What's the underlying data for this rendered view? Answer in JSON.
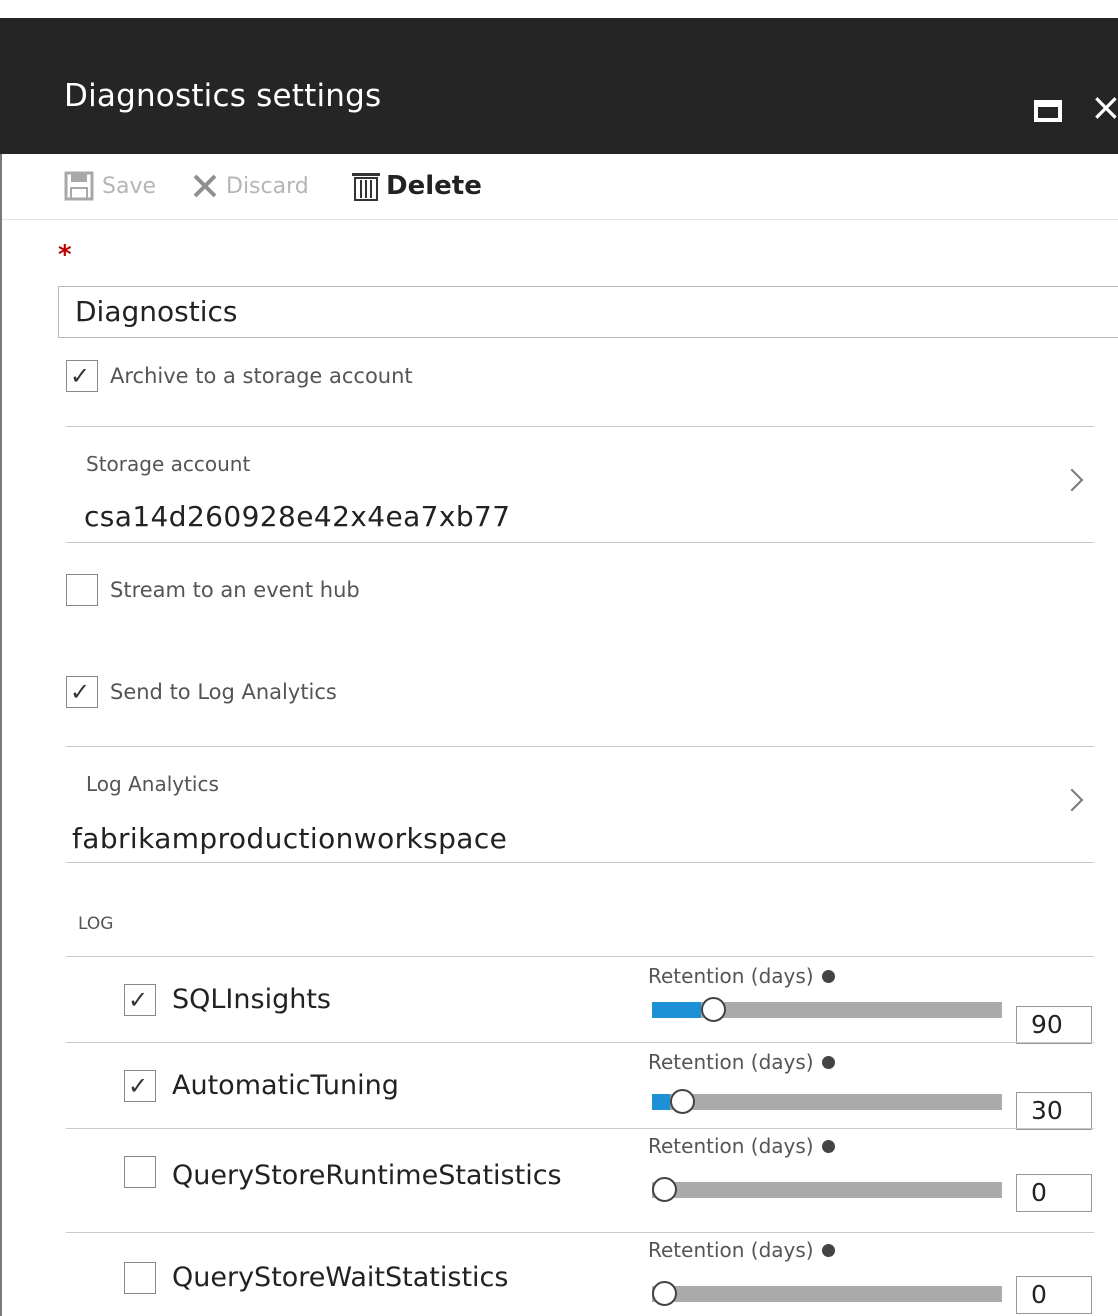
{
  "window": {
    "title": "Diagnostics settings",
    "maximize_icon": "maximize-icon",
    "close_label": "×"
  },
  "toolbar": {
    "save_label": "Save",
    "discard_label": "Discard",
    "delete_label": "Delete"
  },
  "form": {
    "required_marker": "*",
    "name_value": "Diagnostics",
    "archive_label": "Archive to a storage account",
    "archive_checked": true,
    "storage_account_label": "Storage account",
    "storage_account_value": "csa14d260928e42x4ea7xb77",
    "stream_label": "Stream to an event hub",
    "stream_checked": false,
    "log_analytics_send_label": "Send to Log Analytics",
    "log_analytics_send_checked": true,
    "log_analytics_label": "Log Analytics",
    "log_analytics_value": "fabrikamproductionworkspace"
  },
  "logs": {
    "header": "LOG",
    "items": [
      {
        "name": "SQLInsights",
        "checked": true,
        "retention_label": "Retention (days)",
        "retention": "90",
        "level": 0.14
      },
      {
        "name": "AutomaticTuning",
        "checked": true,
        "retention_label": "Retention (days)",
        "retention": "30",
        "level": 0.05
      },
      {
        "name": "QueryStoreRuntimeStatistics",
        "checked": false,
        "retention_label": "Retention (days)",
        "retention": "0",
        "level": 0
      },
      {
        "name": "QueryStoreWaitStatistics",
        "checked": false,
        "retention_label": "Retention (days)",
        "retention": "0",
        "level": 0
      }
    ]
  }
}
